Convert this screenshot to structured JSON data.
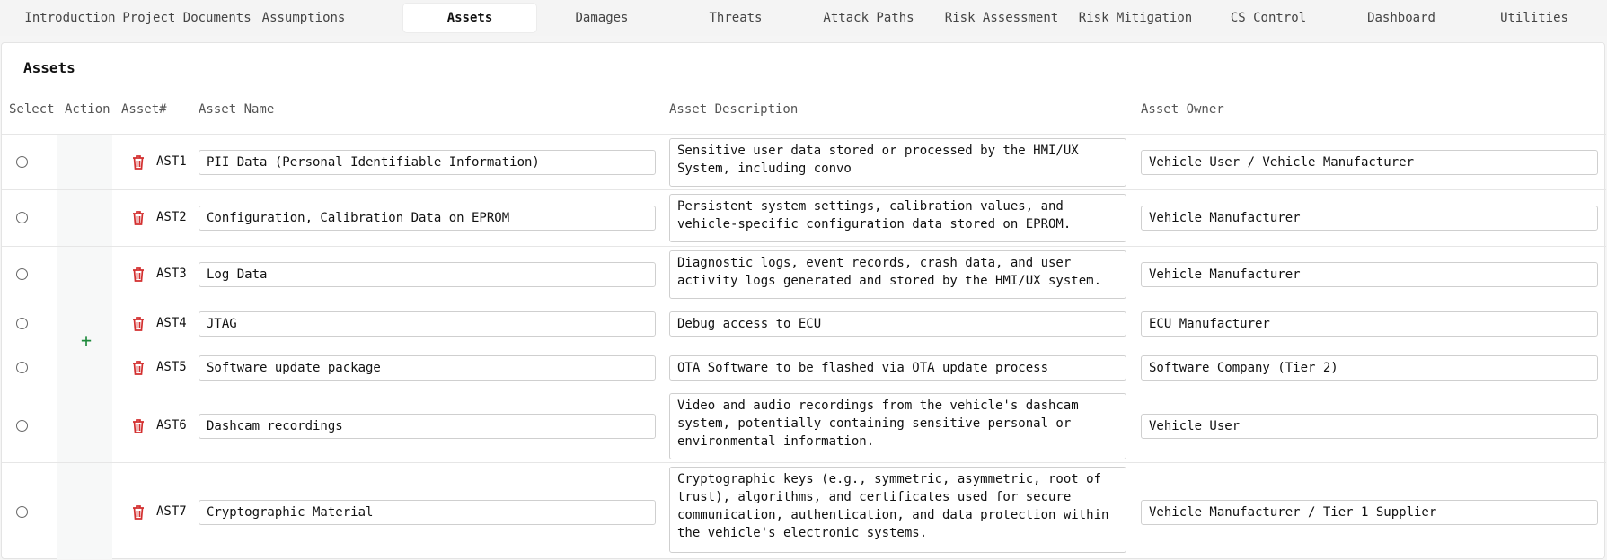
{
  "tabs": [
    {
      "label": "Introduction",
      "active": false
    },
    {
      "label": "Project Documents",
      "active": false
    },
    {
      "label": "Assumptions",
      "active": false
    },
    {
      "label": "Assets",
      "active": true
    },
    {
      "label": "Damages",
      "active": false
    },
    {
      "label": "Threats",
      "active": false
    },
    {
      "label": "Attack Paths",
      "active": false
    },
    {
      "label": "Risk Assessment",
      "active": false
    },
    {
      "label": "Risk Mitigation",
      "active": false
    },
    {
      "label": "CS Control",
      "active": false
    },
    {
      "label": "Dashboard",
      "active": false
    },
    {
      "label": "Utilities",
      "active": false
    }
  ],
  "panel": {
    "title": "Assets",
    "add_icon": "plus-icon",
    "delete_icon": "trash-icon"
  },
  "table": {
    "headers": {
      "select": "Select",
      "action": "Action",
      "asset_num": "Asset#",
      "asset_name": "Asset Name",
      "asset_description": "Asset Description",
      "asset_owner": "Asset Owner"
    },
    "rows": [
      {
        "id": "AST1",
        "name": "PII Data (Personal Identifiable Information)",
        "description": "Sensitive user data stored or processed by the HMI/UX System, including convo",
        "owner": "Vehicle User / Vehicle Manufacturer"
      },
      {
        "id": "AST2",
        "name": "Configuration, Calibration Data on EPROM",
        "description": "Persistent system settings, calibration values, and vehicle-specific configuration data stored on EPROM.",
        "owner": "Vehicle Manufacturer"
      },
      {
        "id": "AST3",
        "name": "Log Data",
        "description": "Diagnostic logs, event records, crash data, and user activity logs generated and stored by the HMI/UX system.",
        "owner": "Vehicle Manufacturer"
      },
      {
        "id": "AST4",
        "name": "JTAG",
        "description": "Debug access to ECU",
        "owner": "ECU Manufacturer"
      },
      {
        "id": "AST5",
        "name": "Software update package",
        "description": "OTA Software to be flashed via OTA update process",
        "owner": "Software Company (Tier 2)"
      },
      {
        "id": "AST6",
        "name": "Dashcam recordings",
        "description": "Video and audio recordings from the vehicle's dashcam system, potentially containing sensitive personal or environmental information.",
        "owner": "Vehicle User"
      },
      {
        "id": "AST7",
        "name": "Cryptographic Material",
        "description": "Cryptographic keys (e.g., symmetric, asymmetric, root of trust), algorithms, and certificates used for secure communication, authentication, and data protection within the vehicle's electronic systems.",
        "owner": "Vehicle Manufacturer / Tier 1 Supplier"
      }
    ]
  },
  "colors": {
    "delete": "#d32f2f",
    "add": "#1e8a3c"
  }
}
